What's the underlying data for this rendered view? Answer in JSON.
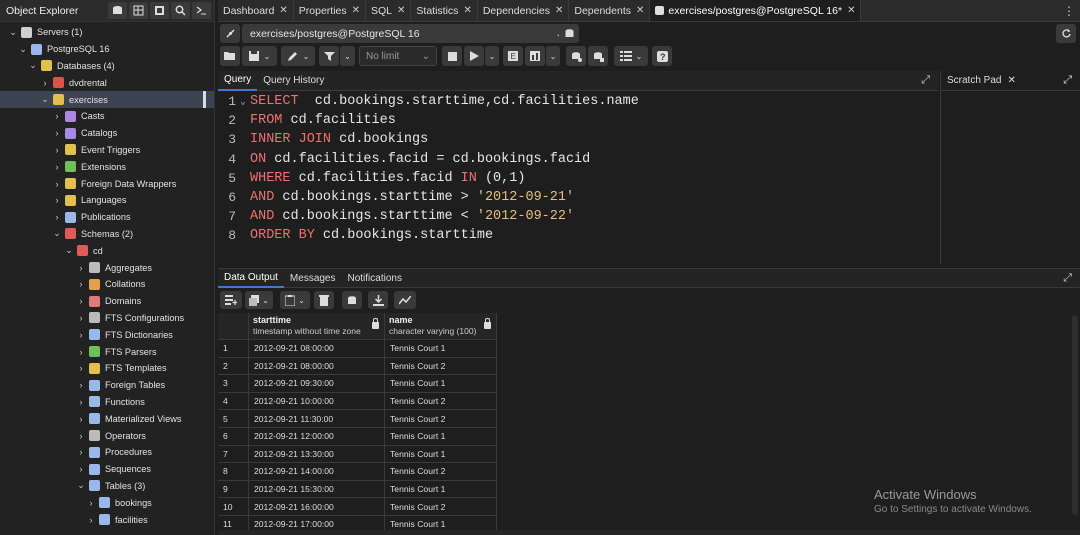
{
  "left_panel": {
    "title": "Object Explorer"
  },
  "tree": [
    {
      "label": "Servers (1)",
      "indent": 0,
      "arrow": "⌄",
      "icon": "servers-icon",
      "color": "#cfcfcf"
    },
    {
      "label": "PostgreSQL 16",
      "indent": 1,
      "arrow": "⌄",
      "icon": "elephant-icon",
      "color": "#9ab8e8"
    },
    {
      "label": "Databases (4)",
      "indent": 2,
      "arrow": "⌄",
      "icon": "databases-icon",
      "color": "#e3c04d"
    },
    {
      "label": "dvdrental",
      "indent": 3,
      "arrow": "›",
      "icon": "database-icon",
      "color": "#d9534f"
    },
    {
      "label": "exercises",
      "indent": 3,
      "arrow": "⌄",
      "icon": "database-icon",
      "color": "#e3c04d",
      "selected": true
    },
    {
      "label": "Casts",
      "indent": 4,
      "arrow": "›",
      "icon": "casts-icon",
      "color": "#a98ae0"
    },
    {
      "label": "Catalogs",
      "indent": 4,
      "arrow": "›",
      "icon": "catalogs-icon",
      "color": "#a98ae0"
    },
    {
      "label": "Event Triggers",
      "indent": 4,
      "arrow": "›",
      "icon": "event-trigger-icon",
      "color": "#e3c04d"
    },
    {
      "label": "Extensions",
      "indent": 4,
      "arrow": "›",
      "icon": "extensions-icon",
      "color": "#6fbf5a"
    },
    {
      "label": "Foreign Data Wrappers",
      "indent": 4,
      "arrow": "›",
      "icon": "fdw-icon",
      "color": "#e3c04d"
    },
    {
      "label": "Languages",
      "indent": 4,
      "arrow": "›",
      "icon": "languages-icon",
      "color": "#e3c04d"
    },
    {
      "label": "Publications",
      "indent": 4,
      "arrow": "›",
      "icon": "publications-icon",
      "color": "#9ab8e8"
    },
    {
      "label": "Schemas (2)",
      "indent": 4,
      "arrow": "⌄",
      "icon": "schemas-icon",
      "color": "#e05a5a"
    },
    {
      "label": "cd",
      "indent": 5,
      "arrow": "⌄",
      "icon": "schema-icon",
      "color": "#e05a5a"
    },
    {
      "label": "Aggregates",
      "indent": 6,
      "arrow": "›",
      "icon": "aggregates-icon",
      "color": "#bbbbbb"
    },
    {
      "label": "Collations",
      "indent": 6,
      "arrow": "›",
      "icon": "collations-icon",
      "color": "#e3a04d"
    },
    {
      "label": "Domains",
      "indent": 6,
      "arrow": "›",
      "icon": "domains-icon",
      "color": "#e07a7a"
    },
    {
      "label": "FTS Configurations",
      "indent": 6,
      "arrow": "›",
      "icon": "fts-config-icon",
      "color": "#bbbbbb"
    },
    {
      "label": "FTS Dictionaries",
      "indent": 6,
      "arrow": "›",
      "icon": "fts-dict-icon",
      "color": "#9ab8e8"
    },
    {
      "label": "FTS Parsers",
      "indent": 6,
      "arrow": "›",
      "icon": "fts-parser-icon",
      "color": "#6fbf5a"
    },
    {
      "label": "FTS Templates",
      "indent": 6,
      "arrow": "›",
      "icon": "fts-template-icon",
      "color": "#e3c04d"
    },
    {
      "label": "Foreign Tables",
      "indent": 6,
      "arrow": "›",
      "icon": "foreign-table-icon",
      "color": "#9ab8e8"
    },
    {
      "label": "Functions",
      "indent": 6,
      "arrow": "›",
      "icon": "functions-icon",
      "color": "#9ab8e8"
    },
    {
      "label": "Materialized Views",
      "indent": 6,
      "arrow": "›",
      "icon": "mat-views-icon",
      "color": "#9ab8e8"
    },
    {
      "label": "Operators",
      "indent": 6,
      "arrow": "›",
      "icon": "operators-icon",
      "color": "#bbbbbb"
    },
    {
      "label": "Procedures",
      "indent": 6,
      "arrow": "›",
      "icon": "procedures-icon",
      "color": "#9ab8e8"
    },
    {
      "label": "Sequences",
      "indent": 6,
      "arrow": "›",
      "icon": "sequences-icon",
      "color": "#9ab8e8"
    },
    {
      "label": "Tables (3)",
      "indent": 6,
      "arrow": "⌄",
      "icon": "tables-icon",
      "color": "#9ab8e8"
    },
    {
      "label": "bookings",
      "indent": 7,
      "arrow": "›",
      "icon": "table-icon",
      "color": "#9ab8e8"
    },
    {
      "label": "facilities",
      "indent": 7,
      "arrow": "›",
      "icon": "table-icon",
      "color": "#9ab8e8"
    }
  ],
  "tabs": [
    {
      "label": "Dashboard"
    },
    {
      "label": "Properties"
    },
    {
      "label": "SQL"
    },
    {
      "label": "Statistics"
    },
    {
      "label": "Dependencies"
    },
    {
      "label": "Dependents"
    },
    {
      "label": "exercises/postgres@PostgreSQL 16*",
      "active": true
    }
  ],
  "connection": {
    "label": "exercises/postgres@PostgreSQL 16"
  },
  "toolbar": {
    "limit_label": "No limit"
  },
  "query_tabs": [
    {
      "label": "Query",
      "active": true
    },
    {
      "label": "Query History"
    }
  ],
  "scratch_pad": {
    "label": "Scratch Pad"
  },
  "editor": {
    "lines": [
      [
        {
          "t": "kw",
          "v": "SELECT"
        },
        {
          "t": "id",
          "v": "  cd.bookings.starttime,cd.facilities.name"
        }
      ],
      [
        {
          "t": "kw",
          "v": "FROM"
        },
        {
          "t": "id",
          "v": " cd.facilities"
        }
      ],
      [
        {
          "t": "kw",
          "v": "INNER JOIN"
        },
        {
          "t": "id",
          "v": " cd.bookings"
        }
      ],
      [
        {
          "t": "kw",
          "v": "ON"
        },
        {
          "t": "id",
          "v": " cd.facilities.facid = cd.bookings.facid"
        }
      ],
      [
        {
          "t": "kw",
          "v": "WHERE"
        },
        {
          "t": "id",
          "v": " cd.facilities.facid "
        },
        {
          "t": "kw",
          "v": "IN"
        },
        {
          "t": "id",
          "v": " (0,1)"
        }
      ],
      [
        {
          "t": "kw",
          "v": "AND"
        },
        {
          "t": "id",
          "v": " cd.bookings.starttime > "
        },
        {
          "t": "str",
          "v": "'2012-09-21'"
        }
      ],
      [
        {
          "t": "kw",
          "v": "AND"
        },
        {
          "t": "id",
          "v": " cd.bookings.starttime < "
        },
        {
          "t": "str",
          "v": "'2012-09-22'"
        }
      ],
      [
        {
          "t": "kw",
          "v": "ORDER BY"
        },
        {
          "t": "id",
          "v": " cd.bookings.starttime"
        }
      ]
    ]
  },
  "output_tabs": [
    {
      "label": "Data Output",
      "active": true
    },
    {
      "label": "Messages"
    },
    {
      "label": "Notifications"
    }
  ],
  "grid": {
    "columns": [
      {
        "name": "starttime",
        "type": "timestamp without time zone"
      },
      {
        "name": "name",
        "type": "character varying (100)"
      }
    ],
    "rows": [
      [
        "1",
        "2012-09-21 08:00:00",
        "Tennis Court 1"
      ],
      [
        "2",
        "2012-09-21 08:00:00",
        "Tennis Court 2"
      ],
      [
        "3",
        "2012-09-21 09:30:00",
        "Tennis Court 1"
      ],
      [
        "4",
        "2012-09-21 10:00:00",
        "Tennis Court 2"
      ],
      [
        "5",
        "2012-09-21 11:30:00",
        "Tennis Court 2"
      ],
      [
        "6",
        "2012-09-21 12:00:00",
        "Tennis Court 1"
      ],
      [
        "7",
        "2012-09-21 13:30:00",
        "Tennis Court 1"
      ],
      [
        "8",
        "2012-09-21 14:00:00",
        "Tennis Court 2"
      ],
      [
        "9",
        "2012-09-21 15:30:00",
        "Tennis Court 1"
      ],
      [
        "10",
        "2012-09-21 16:00:00",
        "Tennis Court 2"
      ],
      [
        "11",
        "2012-09-21 17:00:00",
        "Tennis Court 1"
      ]
    ]
  },
  "watermark": {
    "line1": "Activate Windows",
    "line2": "Go to Settings to activate Windows."
  }
}
